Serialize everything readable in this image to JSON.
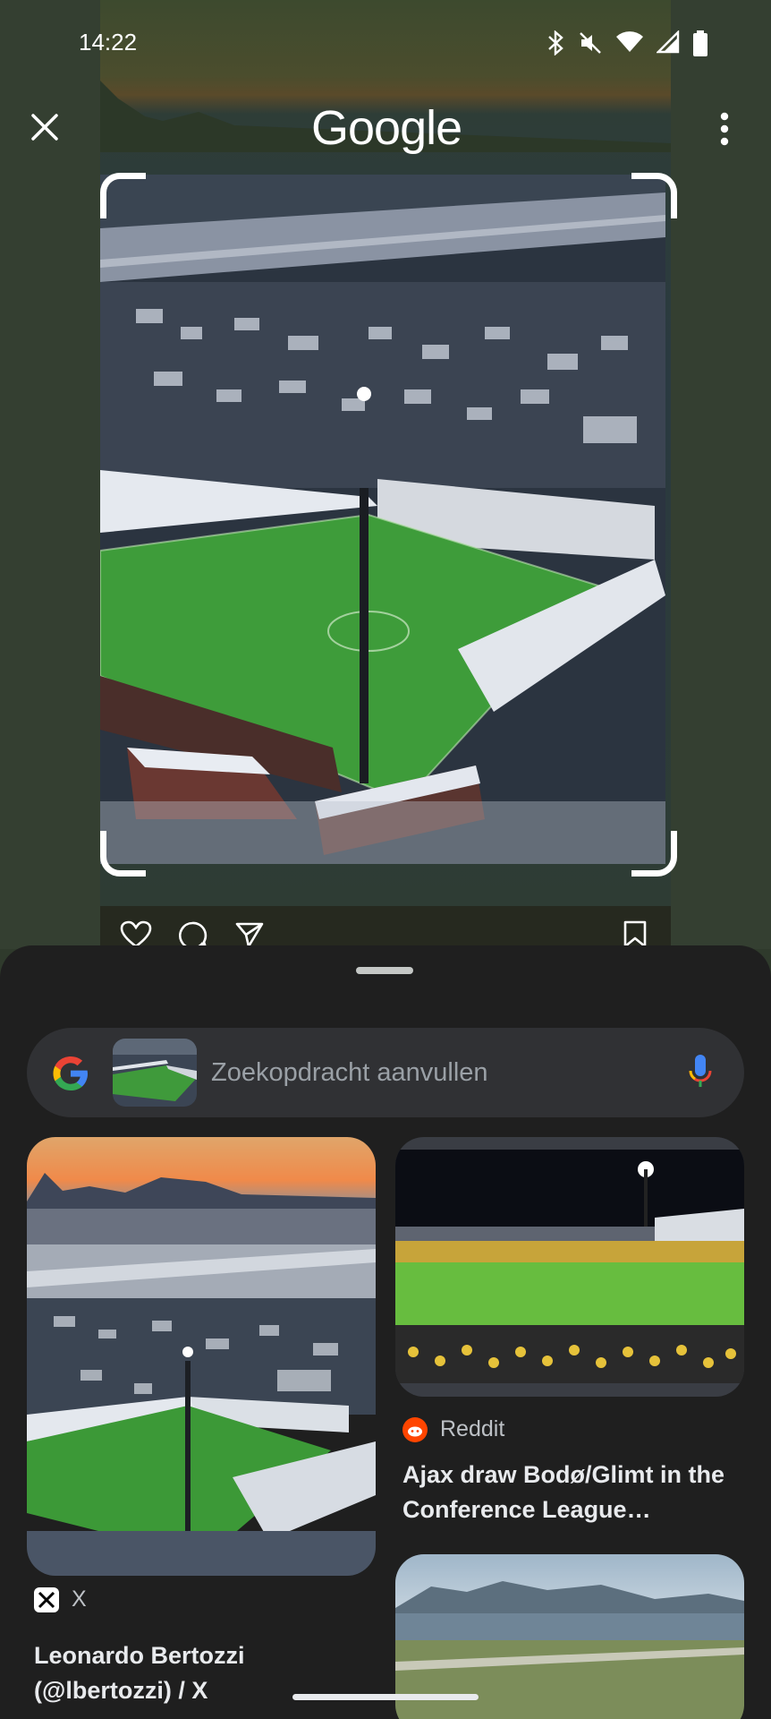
{
  "status_bar": {
    "time": "14:22",
    "icons": [
      "bluetooth-icon",
      "mute-icon",
      "wifi-icon",
      "signal-icon",
      "battery-icon"
    ]
  },
  "header": {
    "logo_text": "Google",
    "close_icon": "close-icon",
    "more_icon": "more-vert-icon"
  },
  "captured_post": {
    "icons": [
      "heart-icon",
      "comment-icon",
      "share-icon",
      "bookmark-icon"
    ]
  },
  "search": {
    "placeholder": "Zoekopdracht aanvullen",
    "mic_icon": "mic-icon"
  },
  "results": [
    {
      "source": "X",
      "title": "Leonardo Bertozzi (@lbertozzi) / X"
    },
    {
      "source": "Reddit",
      "title": "Ajax draw Bodø/Glimt in the Conference League…"
    }
  ],
  "colors": {
    "sheet_bg": "#1f1f1f",
    "search_bg": "#303134",
    "reddit_orange": "#ff4500"
  }
}
